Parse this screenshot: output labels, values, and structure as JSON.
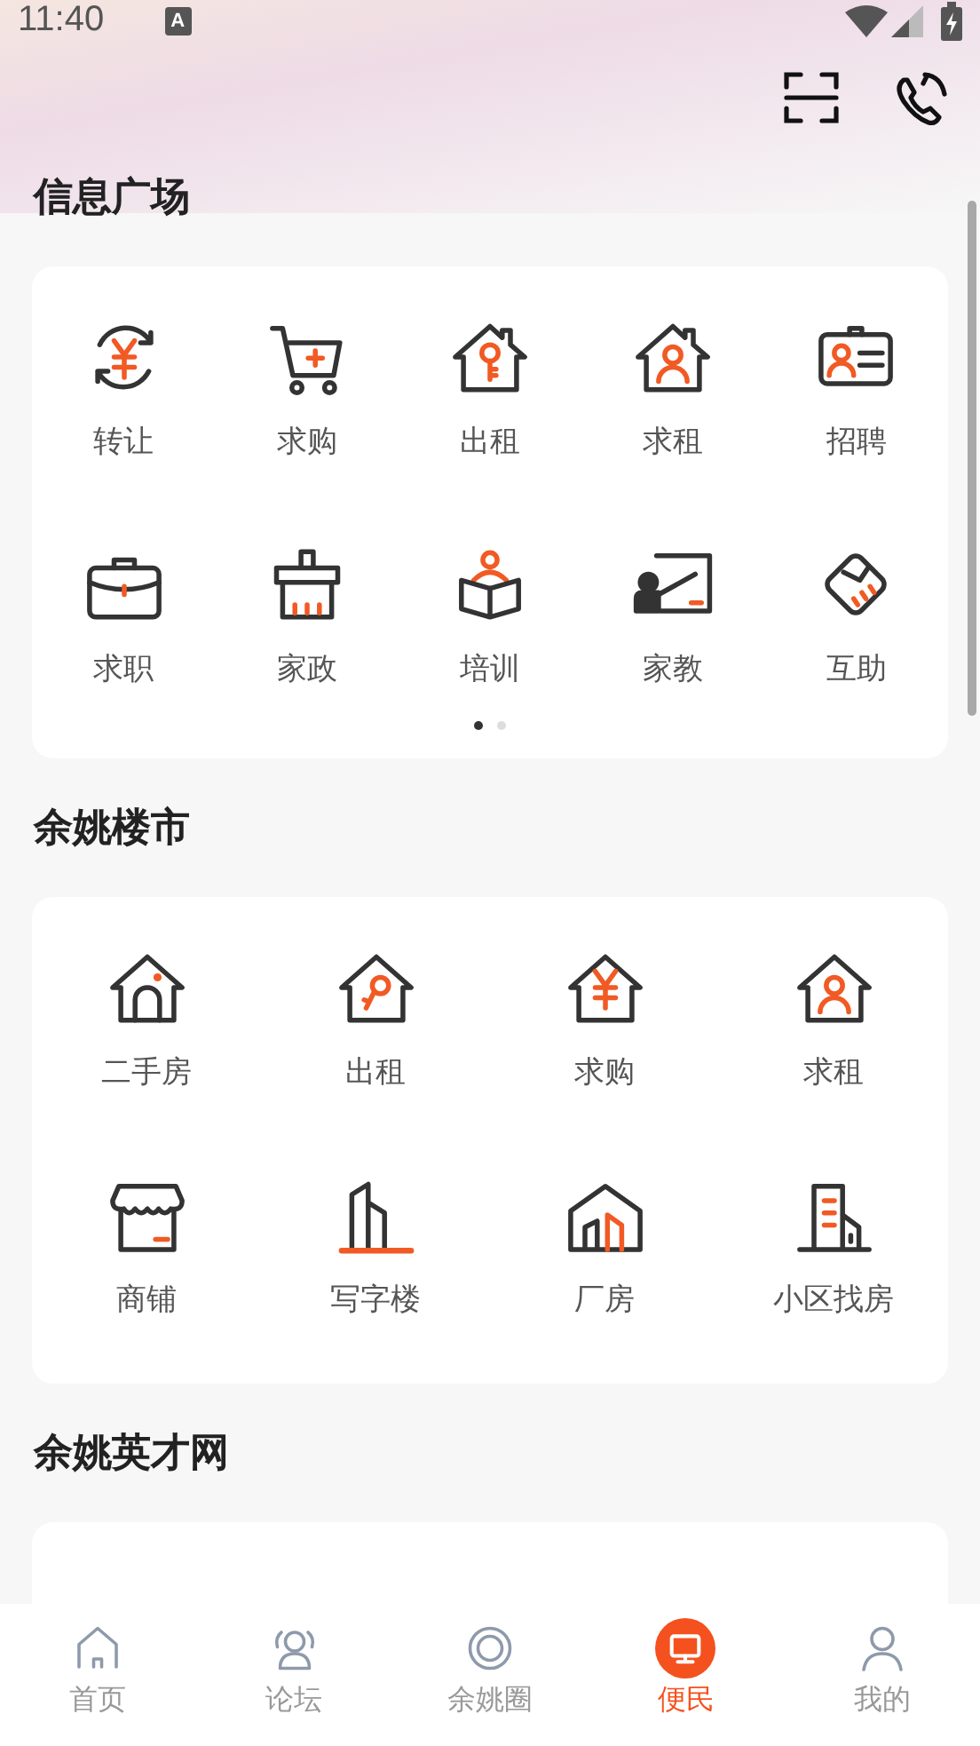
{
  "status_bar": {
    "time": "11:40",
    "notification": "A"
  },
  "sections": [
    {
      "title": "信息广场",
      "items": [
        {
          "label": "转让"
        },
        {
          "label": "求购"
        },
        {
          "label": "出租"
        },
        {
          "label": "求租"
        },
        {
          "label": "招聘"
        },
        {
          "label": "求职"
        },
        {
          "label": "家政"
        },
        {
          "label": "培训"
        },
        {
          "label": "家教"
        },
        {
          "label": "互助"
        }
      ],
      "pages": [
        {
          "selected": true
        },
        {
          "selected": false
        }
      ]
    },
    {
      "title": "余姚楼市",
      "items": [
        {
          "label": "二手房"
        },
        {
          "label": "出租"
        },
        {
          "label": "求购"
        },
        {
          "label": "求租"
        },
        {
          "label": "商铺"
        },
        {
          "label": "写字楼"
        },
        {
          "label": "厂房"
        },
        {
          "label": "小区找房"
        }
      ]
    },
    {
      "title": "余姚英才网"
    }
  ],
  "tab_bar": [
    {
      "label": "首页",
      "selected": false
    },
    {
      "label": "论坛",
      "selected": false
    },
    {
      "label": "余姚圈",
      "selected": false
    },
    {
      "label": "便民",
      "selected": true
    },
    {
      "label": "我的",
      "selected": false
    }
  ]
}
